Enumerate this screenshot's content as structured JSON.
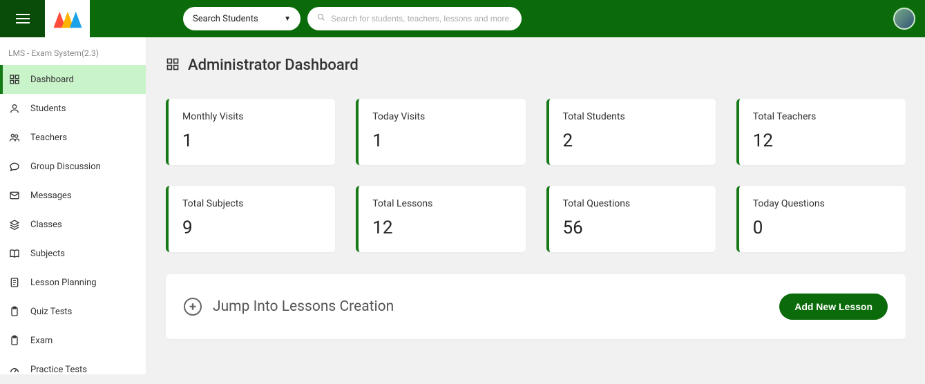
{
  "header": {
    "search_dropdown_label": "Search Students",
    "search_placeholder": "Search for students, teachers, lessons and more..."
  },
  "sidebar": {
    "title": "LMS - Exam System(2.3)",
    "items": [
      {
        "label": "Dashboard",
        "icon": "grid-icon",
        "active": true
      },
      {
        "label": "Students",
        "icon": "person-icon"
      },
      {
        "label": "Teachers",
        "icon": "people-icon"
      },
      {
        "label": "Group Discussion",
        "icon": "chat-icon"
      },
      {
        "label": "Messages",
        "icon": "mail-icon"
      },
      {
        "label": "Classes",
        "icon": "layers-icon"
      },
      {
        "label": "Subjects",
        "icon": "book-icon"
      },
      {
        "label": "Lesson Planning",
        "icon": "note-icon"
      },
      {
        "label": "Quiz Tests",
        "icon": "clipboard-icon"
      },
      {
        "label": "Exam",
        "icon": "clipboard-icon"
      },
      {
        "label": "Practice Tests",
        "icon": "gauge-icon"
      }
    ]
  },
  "page": {
    "title": "Administrator Dashboard"
  },
  "stats": [
    {
      "label": "Monthly Visits",
      "value": "1"
    },
    {
      "label": "Today Visits",
      "value": "1"
    },
    {
      "label": "Total Students",
      "value": "2"
    },
    {
      "label": "Total Teachers",
      "value": "12"
    },
    {
      "label": "Total Subjects",
      "value": "9"
    },
    {
      "label": "Total Lessons",
      "value": "12"
    },
    {
      "label": "Total Questions",
      "value": "56"
    },
    {
      "label": "Today Questions",
      "value": "0"
    }
  ],
  "cta": {
    "text": "Jump Into Lessons Creation",
    "button": "Add New Lesson"
  }
}
